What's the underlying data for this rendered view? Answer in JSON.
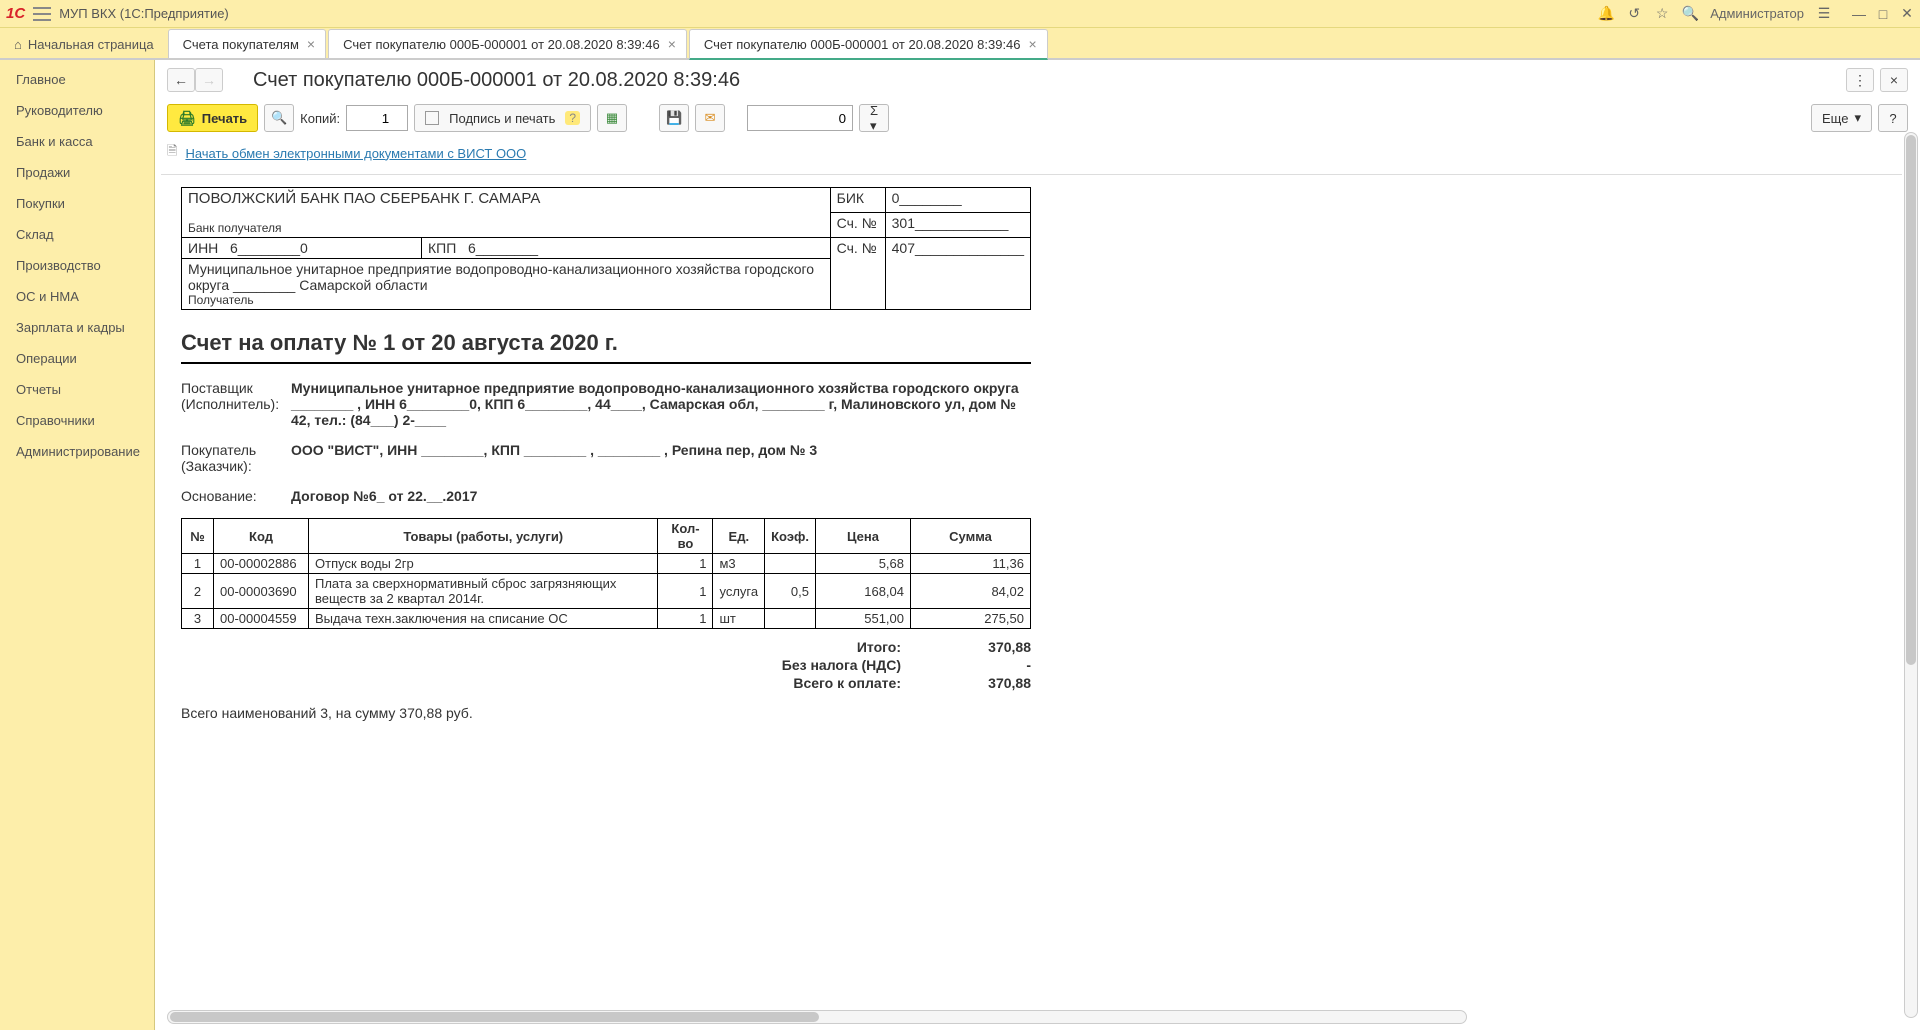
{
  "app": {
    "title": "МУП ВКХ  (1С:Предприятие)",
    "user": "Администратор"
  },
  "tabs": {
    "home": "Начальная страница",
    "t1": "Счета покупателям",
    "t2": "Счет покупателю 000Б-000001 от 20.08.2020 8:39:46",
    "t3": "Счет покупателю 000Б-000001 от 20.08.2020 8:39:46"
  },
  "sidebar": {
    "items": [
      "Главное",
      "Руководителю",
      "Банк и касса",
      "Продажи",
      "Покупки",
      "Склад",
      "Производство",
      "ОС и НМА",
      "Зарплата и кадры",
      "Операции",
      "Отчеты",
      "Справочники",
      "Администрирование"
    ]
  },
  "header": {
    "title": "Счет покупателю 000Б-000001 от 20.08.2020 8:39:46"
  },
  "toolbar": {
    "print": "Печать",
    "copies_label": "Копий:",
    "copies_value": "1",
    "sign_and_print": "Подпись и печать",
    "money": "0",
    "more": "Еще",
    "help": "?"
  },
  "link": {
    "text": "Начать обмен электронными документами с ВИСТ ООО"
  },
  "bank": {
    "bank_name": "ПОВОЛЖСКИЙ БАНК ПАО СБЕРБАНК Г. САМАРА",
    "bank_label": "Банк получателя",
    "bik_label": "БИК",
    "bik": "0________",
    "acc_label": "Сч. №",
    "acc1": "301____________",
    "inn_label": "ИНН",
    "inn": "6________0",
    "kpp_label": "КПП",
    "kpp": "6________",
    "acc2_label": "Сч. №",
    "acc2": "407______________",
    "recipient_name": "Муниципальное унитарное предприятие водопроводно-канализационного хозяйства городского округа ________ Самарской области",
    "recipient_label": "Получатель"
  },
  "invoice": {
    "title": "Счет на оплату № 1 от 20 августа 2020 г.",
    "supplier_label1": "Поставщик",
    "supplier_label2": "(Исполнитель):",
    "supplier_value": "Муниципальное унитарное предприятие водопроводно-канализационного хозяйства городского округа ________ , ИНН 6________0, КПП 6________, 44____, Самарская обл, ________ г, Малиновского ул, дом № 42, тел.: (84___) 2-____",
    "buyer_label1": "Покупатель",
    "buyer_label2": "(Заказчик):",
    "buyer_value": "ООО \"ВИСТ\", ИНН ________, КПП ________ , ________ , Репина пер, дом № 3",
    "basis_label": "Основание:",
    "basis_value": "Договор №6_ от 22.__.2017"
  },
  "items": {
    "headers": {
      "n": "№",
      "code": "Код",
      "name": "Товары (работы, услуги)",
      "qty": "Кол-во",
      "unit": "Ед.",
      "coef": "Коэф.",
      "price": "Цена",
      "sum": "Сумма"
    },
    "rows": [
      {
        "n": "1",
        "code": "00-00002886",
        "name": "Отпуск воды 2гр",
        "qty": "1",
        "unit": "м3",
        "coef": "",
        "price": "5,68",
        "sum": "11,36"
      },
      {
        "n": "2",
        "code": "00-00003690",
        "name": "Плата за сверхнормативный сброс загрязняющих веществ за 2 квартал 2014г.",
        "qty": "1",
        "unit": "услуга",
        "coef": "0,5",
        "price": "168,04",
        "sum": "84,02"
      },
      {
        "n": "3",
        "code": "00-00004559",
        "name": "Выдача техн.заключения на списание ОС",
        "qty": "1",
        "unit": "шт",
        "coef": "",
        "price": "551,00",
        "sum": "275,50"
      }
    ]
  },
  "totals": {
    "itogo_label": "Итого:",
    "itogo": "370,88",
    "novat_label": "Без налога (НДС)",
    "novat": "-",
    "total_label": "Всего к оплате:",
    "total": "370,88",
    "summary": "Всего наименований 3, на сумму 370,88 руб."
  }
}
